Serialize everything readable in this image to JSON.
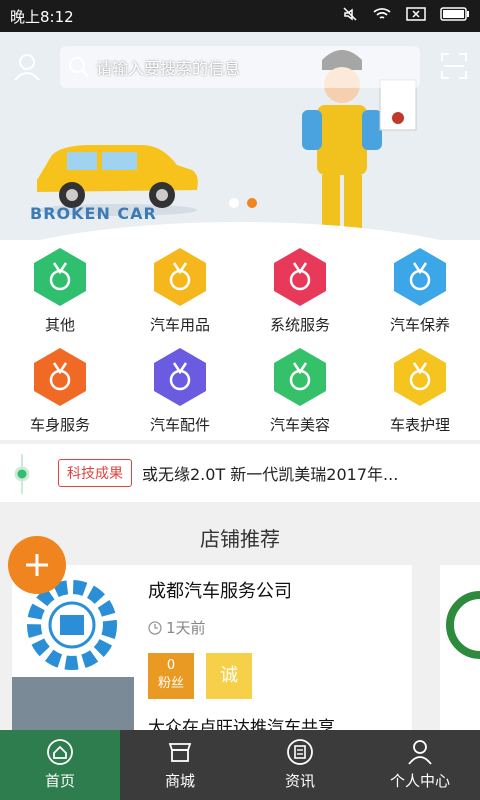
{
  "status_bar": {
    "time": "晚上8:12"
  },
  "search": {
    "placeholder": "请输入要搜索的信息"
  },
  "banner": {
    "caption": "BROKEN CAR"
  },
  "categories": [
    {
      "label": "其他",
      "color": "#2fbf6f"
    },
    {
      "label": "汽车用品",
      "color": "#f5b71b"
    },
    {
      "label": "系统服务",
      "color": "#e8395a"
    },
    {
      "label": "汽车保养",
      "color": "#3ba7e8"
    },
    {
      "label": "车身服务",
      "color": "#f06a25"
    },
    {
      "label": "汽车配件",
      "color": "#6a5be0"
    },
    {
      "label": "汽车美容",
      "color": "#35c16a"
    },
    {
      "label": "车表护理",
      "color": "#f5c41e"
    }
  ],
  "news": {
    "tag": "科技成果",
    "headline": "或无缘2.0T 新一代凯美瑞2017年..."
  },
  "shop_section": {
    "title": "店铺推荐",
    "card": {
      "name": "成都汽车服务公司",
      "time": "1天前",
      "fans_count": "0",
      "fans_label": "粉丝",
      "badge": "诚",
      "subtitle": "大众在卢旺达推汽车共享..."
    }
  },
  "tabbar": [
    {
      "label": "首页",
      "icon": "home-icon"
    },
    {
      "label": "商城",
      "icon": "store-icon"
    },
    {
      "label": "资讯",
      "icon": "news-icon"
    },
    {
      "label": "个人中心",
      "icon": "user-icon"
    }
  ],
  "colors": {
    "accent": "#f0841e",
    "tab_active": "#2e7d4f",
    "tab_bg": "#3b3b3b",
    "tag_red": "#e0443d"
  }
}
